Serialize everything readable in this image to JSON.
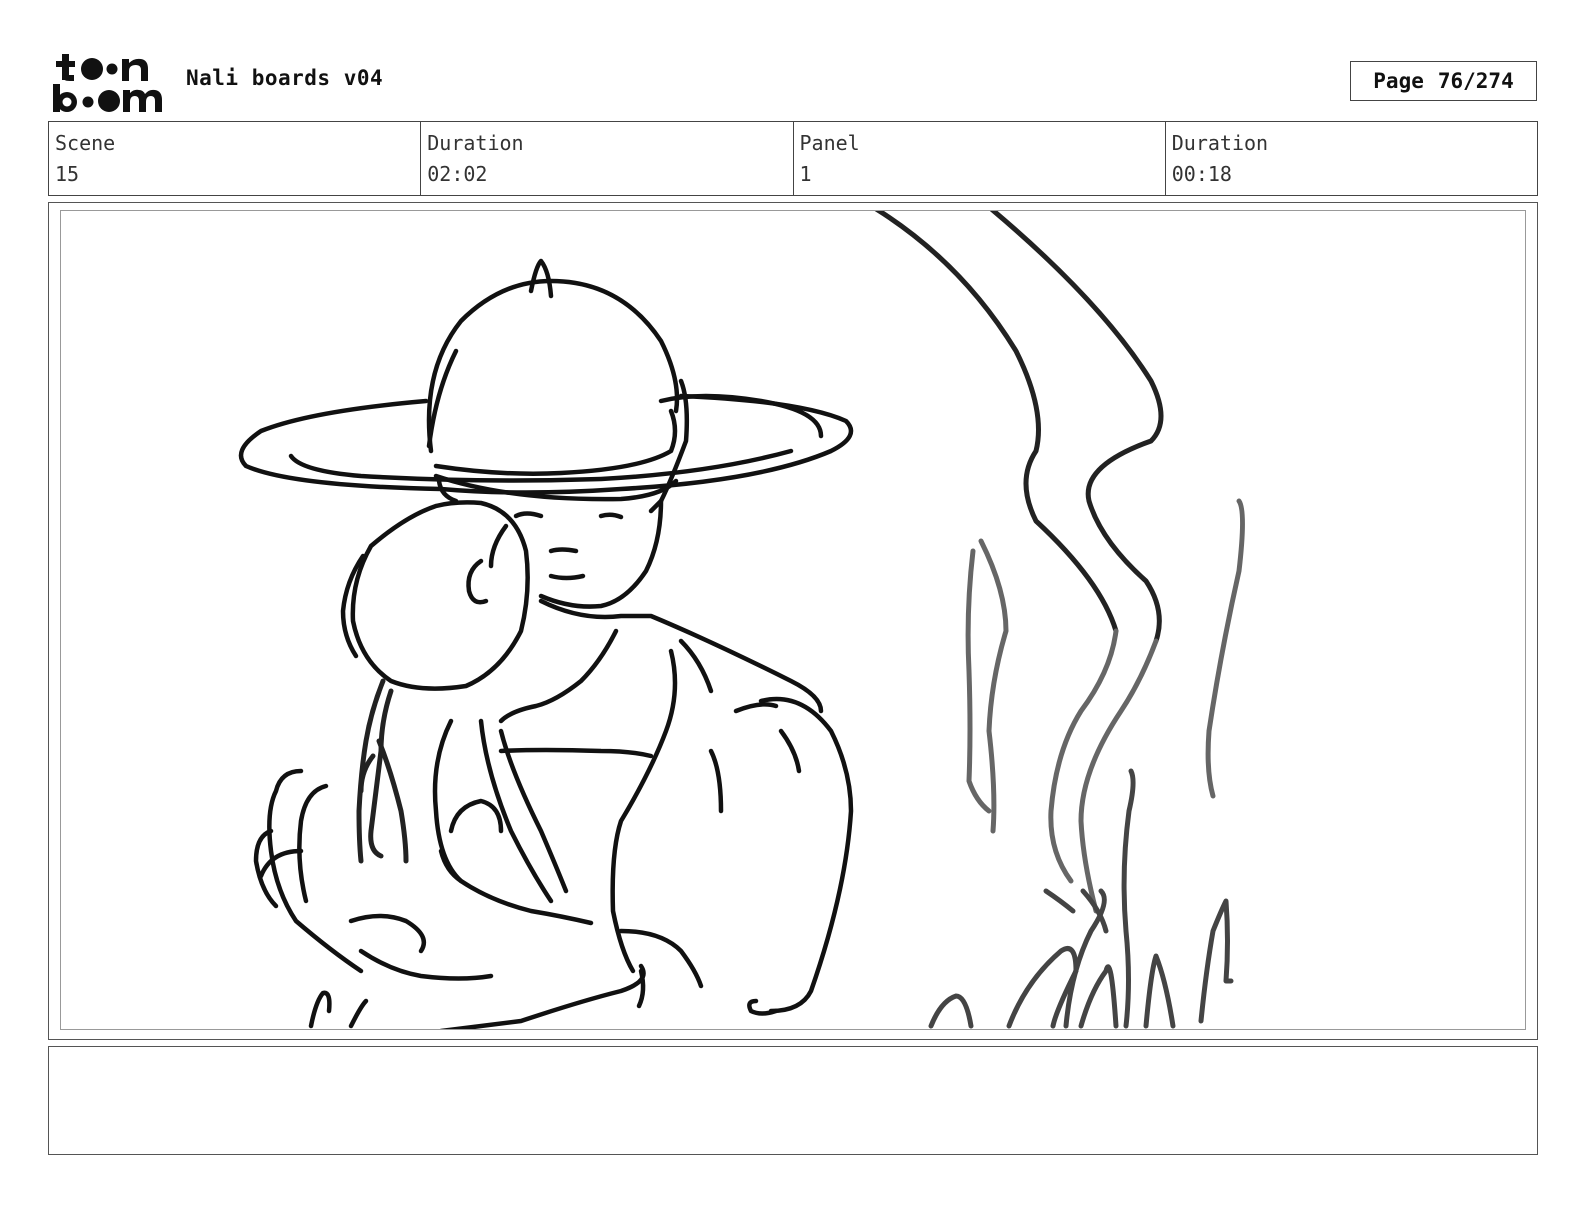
{
  "header": {
    "title": "Nali boards v04",
    "page_label": "Page",
    "page_value": "76/274"
  },
  "info": {
    "scene_label": "Scene",
    "scene_value": "15",
    "scene_duration_label": "Duration",
    "scene_duration_value": "02:02",
    "panel_label": "Panel",
    "panel_value": "1",
    "panel_duration_label": "Duration",
    "panel_duration_value": "00:18"
  },
  "notes": {
    "text": ""
  },
  "icons": {
    "logo": "toonboom-logo"
  },
  "colors": {
    "ink": "#111111",
    "border": "#444444"
  }
}
